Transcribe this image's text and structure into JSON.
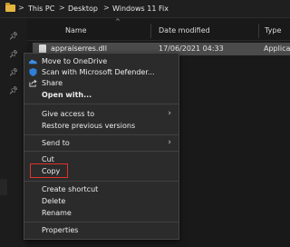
{
  "address": {
    "crumbs": [
      "This PC",
      "Desktop",
      "Windows 11 Fix"
    ],
    "separator": ">"
  },
  "columns": {
    "name": "Name",
    "sort_arrow": "^",
    "date_modified": "Date modified",
    "type": "Type"
  },
  "file": {
    "name": "appraiserres.dll",
    "date": "17/06/2021 04:33",
    "type": "Applicatio"
  },
  "menu": {
    "items": [
      {
        "label": "Move to OneDrive",
        "icon": "onedrive-icon"
      },
      {
        "label": "Scan with Microsoft Defender...",
        "icon": "defender-icon"
      },
      {
        "label": "Share",
        "icon": "share-icon"
      },
      {
        "label": "Open with..."
      },
      {
        "label": "Give access to",
        "submenu": true
      },
      {
        "label": "Restore previous versions"
      },
      {
        "label": "Send to",
        "submenu": true
      },
      {
        "label": "Cut"
      },
      {
        "label": "Copy",
        "highlighted": true
      },
      {
        "label": "Create shortcut"
      },
      {
        "label": "Delete"
      },
      {
        "label": "Rename"
      },
      {
        "label": "Properties"
      }
    ],
    "submenu_arrow": "›"
  },
  "colors": {
    "highlight_border": "#e0332b",
    "selected_row": "#4b4b4b",
    "menu_bg": "#2b2b2b",
    "onedrive": "#3a8ee6",
    "defender": "#2f7fd8",
    "folder": "#e6b640"
  },
  "nav_pins": [
    "pin-icon",
    "pin-icon",
    "pin-icon",
    "pin-icon"
  ]
}
